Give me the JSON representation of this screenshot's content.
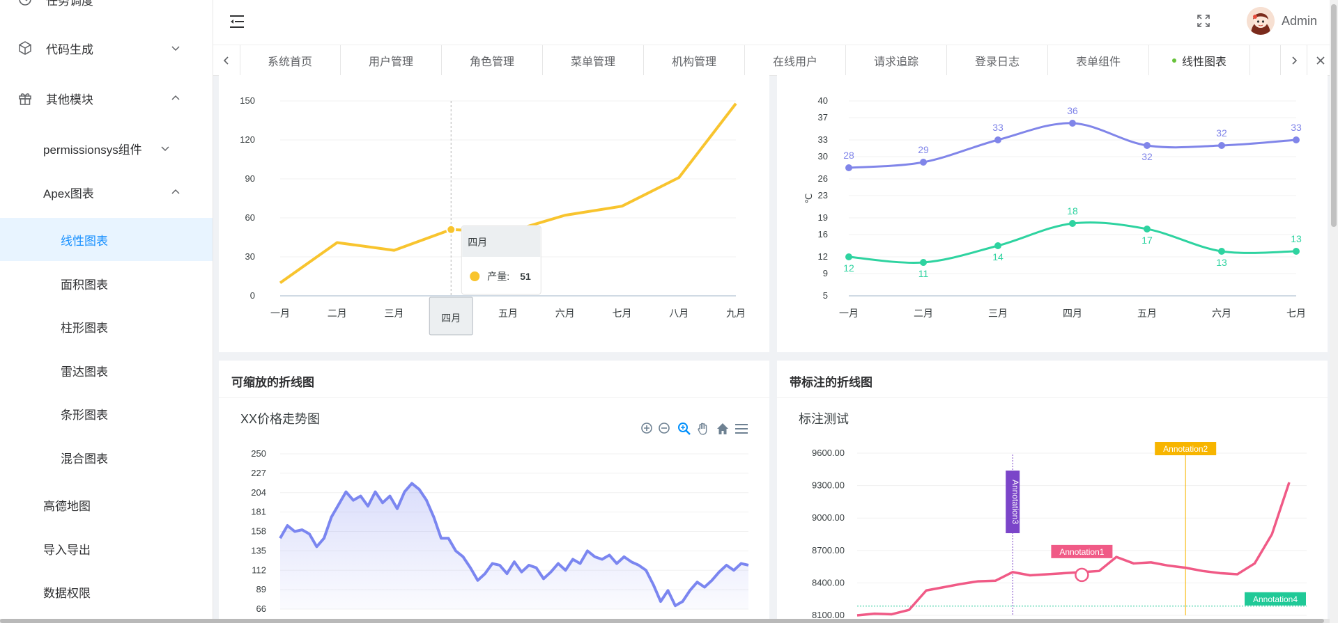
{
  "sidebar": {
    "items": [
      {
        "label": "任务调度",
        "icon": "clock-icon"
      },
      {
        "label": "代码生成",
        "icon": "cube-icon"
      },
      {
        "label": "其他模块",
        "icon": "gift-icon"
      },
      {
        "label": "permissionsys组件"
      },
      {
        "label": "Apex图表"
      },
      {
        "label": "线性图表"
      },
      {
        "label": "面积图表"
      },
      {
        "label": "柱形图表"
      },
      {
        "label": "雷达图表"
      },
      {
        "label": "条形图表"
      },
      {
        "label": "混合图表"
      },
      {
        "label": "高德地图"
      },
      {
        "label": "导入导出"
      },
      {
        "label": "数据权限"
      }
    ]
  },
  "header": {
    "user_name": "Admin",
    "icons": [
      "hamburger-icon",
      "fullscreen-icon",
      "avatar"
    ]
  },
  "tags": {
    "items": [
      "系统首页",
      "用户管理",
      "角色管理",
      "菜单管理",
      "机构管理",
      "在线用户",
      "请求追踪",
      "登录日志",
      "表单组件",
      "线性图表"
    ],
    "active": "线性图表"
  },
  "cards": {
    "zoom": {
      "title": "可缩放的折线图",
      "chart_title": "XX价格走势图"
    },
    "annot": {
      "title": "带标注的折线图",
      "chart_title": "标注测试"
    }
  },
  "chart_data": [
    {
      "type": "line",
      "categories": [
        "一月",
        "二月",
        "三月",
        "四月",
        "五月",
        "六月",
        "七月",
        "八月",
        "九月"
      ],
      "series": [
        {
          "name": "产量",
          "values": [
            10,
            41,
            35,
            51,
            49,
            62,
            69,
            91,
            148
          ]
        }
      ],
      "ylim": [
        0,
        150
      ],
      "yticks": [
        0,
        30,
        60,
        90,
        120,
        150
      ],
      "tooltip": {
        "category": "四月",
        "series": "产量",
        "value": 51
      },
      "color": "#f8c42e"
    },
    {
      "type": "line",
      "categories": [
        "一月",
        "二月",
        "三月",
        "四月",
        "五月",
        "六月",
        "七月"
      ],
      "series": [
        {
          "values": [
            28,
            29,
            33,
            36,
            32,
            32,
            33
          ],
          "color": "#8085e9"
        },
        {
          "values": [
            12,
            11,
            14,
            18,
            17,
            13,
            13
          ],
          "color": "#2ed3a0"
        }
      ],
      "ylabel": "℃",
      "ylim": [
        5,
        40
      ],
      "yticks": [
        5,
        9,
        12,
        16,
        19,
        23,
        26,
        30,
        33,
        37,
        40
      ]
    },
    {
      "type": "area",
      "title": "XX价格走势图",
      "ylim": [
        66,
        250
      ],
      "yticks": [
        66,
        89,
        112,
        135,
        158,
        181,
        204,
        227,
        250
      ],
      "values": [
        150,
        165,
        158,
        160,
        155,
        140,
        150,
        175,
        190,
        205,
        195,
        200,
        188,
        205,
        192,
        200,
        185,
        205,
        215,
        208,
        195,
        175,
        150,
        150,
        135,
        128,
        115,
        100,
        108,
        120,
        118,
        108,
        122,
        110,
        118,
        115,
        102,
        110,
        120,
        112,
        125,
        120,
        135,
        128,
        125,
        130,
        120,
        128,
        122,
        118,
        112,
        95,
        75,
        88,
        70,
        75,
        88,
        98,
        92,
        100,
        110,
        118,
        112,
        120,
        118
      ],
      "toolbar": [
        "zoom-in-icon",
        "zoom-out-icon",
        "selection-zoom-icon",
        "pan-icon",
        "home-icon",
        "menu-icon"
      ],
      "color": "#7b86f0"
    },
    {
      "type": "line",
      "title": "标注测试",
      "ylim": [
        8100,
        9600
      ],
      "yticks": [
        "8100.00",
        "8400.00",
        "8700.00",
        "9000.00",
        "9300.00",
        "9600.00"
      ],
      "values": [
        8100,
        8115,
        8110,
        8150,
        8330,
        8360,
        8390,
        8415,
        8420,
        8500,
        8470,
        8480,
        8490,
        8500,
        8510,
        8640,
        8580,
        8590,
        8560,
        8540,
        8510,
        8490,
        8480,
        8580,
        8850,
        9330
      ],
      "annotations": [
        {
          "label": "Annotation1",
          "color": "#f05a86"
        },
        {
          "label": "Annotation2",
          "color": "#f7b500"
        },
        {
          "label": "Annotation3",
          "color": "#7b45c9"
        },
        {
          "label": "Annotation4",
          "color": "#20c997"
        }
      ],
      "color": "#f05a86"
    }
  ]
}
